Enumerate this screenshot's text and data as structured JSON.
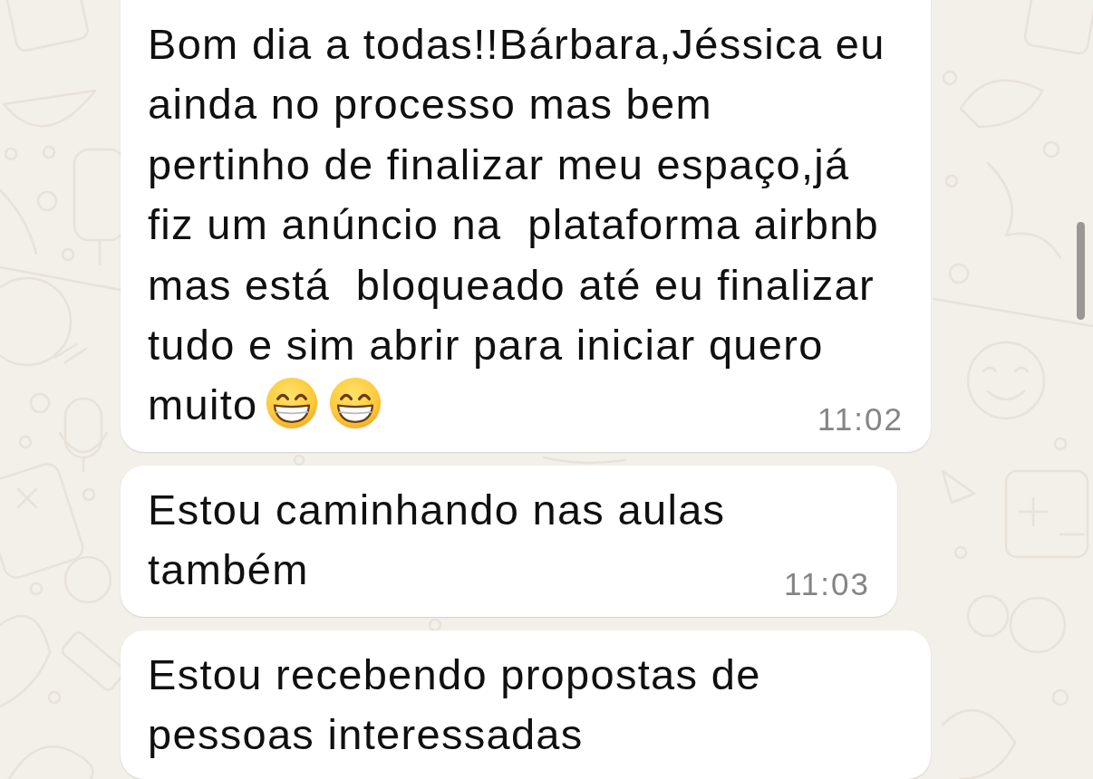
{
  "messages": [
    {
      "text": "Bom dia a todas!!Bárbara,Jéssica eu\nainda no processo mas bem\npertinho de finalizar meu espaço,já\nfiz um anúncio na  plataforma airbnb\nmas está  bloqueado até eu finalizar\ntudo e sim abrir para iniciar quero\nmuito",
      "emojis": [
        {
          "kind": "grin"
        },
        {
          "kind": "grin"
        }
      ],
      "time": "11:02"
    },
    {
      "text": "Estou caminhando nas aulas\ntambém",
      "time": "11:03"
    },
    {
      "text": "Estou recebendo propostas de\npessoas interessadas"
    }
  ]
}
